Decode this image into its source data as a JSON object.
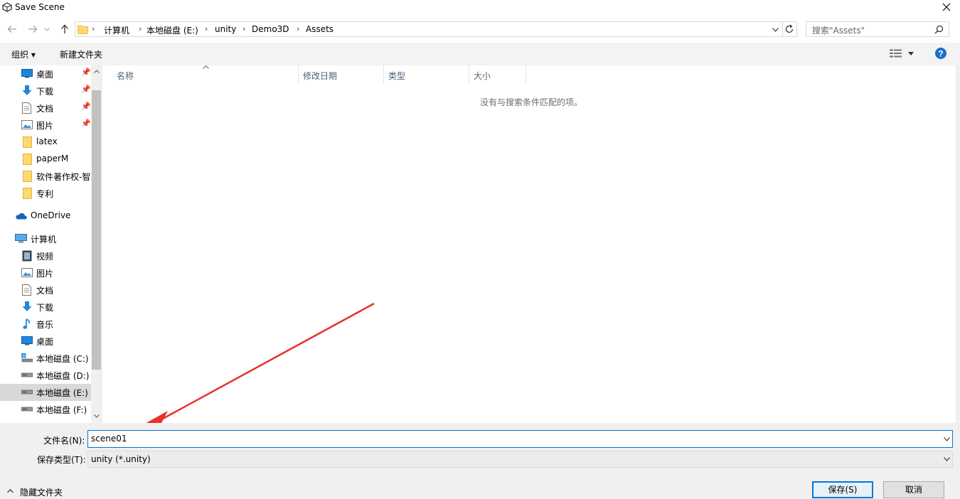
{
  "window": {
    "title": "Save Scene"
  },
  "address": {
    "crumbs": [
      "计算机",
      "本地磁盘 (E:)",
      "unity",
      "Demo3D",
      "Assets"
    ],
    "search_placeholder": "搜索\"Assets\""
  },
  "toolbar": {
    "organize": "组织 ▾",
    "new_folder": "新建文件夹"
  },
  "nav": {
    "quick_access": [
      {
        "label": "桌面",
        "icon": "desktop-icon",
        "pinned": true
      },
      {
        "label": "下载",
        "icon": "download-icon",
        "pinned": true
      },
      {
        "label": "文档",
        "icon": "document-icon",
        "pinned": true
      },
      {
        "label": "图片",
        "icon": "pictures-icon",
        "pinned": true
      },
      {
        "label": "latex",
        "icon": "folder-icon"
      },
      {
        "label": "paperM",
        "icon": "folder-icon"
      },
      {
        "label": "软件著作权-智",
        "icon": "folder-icon"
      },
      {
        "label": "专利",
        "icon": "folder-icon"
      }
    ],
    "onedrive": "OneDrive",
    "computer": "计算机",
    "computer_items": [
      {
        "label": "视频",
        "icon": "video-icon"
      },
      {
        "label": "图片",
        "icon": "pictures-icon"
      },
      {
        "label": "文档",
        "icon": "document-icon"
      },
      {
        "label": "下载",
        "icon": "download-icon"
      },
      {
        "label": "音乐",
        "icon": "music-icon"
      },
      {
        "label": "桌面",
        "icon": "desktop-icon"
      },
      {
        "label": "本地磁盘 (C:)",
        "icon": "system-drive-icon"
      },
      {
        "label": "本地磁盘 (D:)",
        "icon": "drive-icon"
      },
      {
        "label": "本地磁盘 (E:)",
        "icon": "drive-icon",
        "selected": true
      },
      {
        "label": "本地磁盘 (F:)",
        "icon": "drive-icon"
      }
    ]
  },
  "files": {
    "columns": [
      "名称",
      "修改日期",
      "类型",
      "大小"
    ],
    "empty_message": "没有与搜索条件匹配的项。"
  },
  "bottom": {
    "filename_label": "文件名(N):",
    "filename_value": "scene01",
    "filetype_label": "保存类型(T):",
    "filetype_value": "unity (*.unity)",
    "save": "保存(S)",
    "cancel": "取消",
    "hide_folders": "隐藏文件夹"
  },
  "colors": {
    "accent": "#0078d7",
    "annotation_arrow": "#e8302a",
    "folder": "#ffd86e"
  }
}
